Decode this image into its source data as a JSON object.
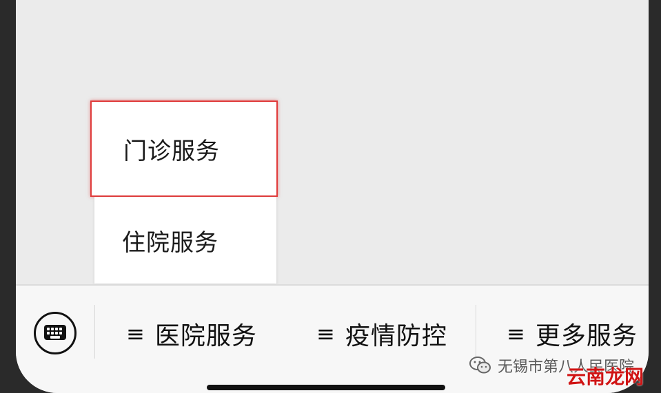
{
  "popup_menu": {
    "items": [
      {
        "label": "门诊服务",
        "selected": true
      },
      {
        "label": "住院服务",
        "selected": false
      }
    ],
    "highlight_color": "#e03b3b"
  },
  "bottom_bar": {
    "keyboard_icon": "keyboard-icon",
    "menus": [
      {
        "icon": "≡",
        "label": "医院服务"
      },
      {
        "icon": "≡",
        "label": "疫情防控"
      },
      {
        "icon": "≡",
        "label": "更多服务"
      }
    ]
  },
  "watermark": {
    "account": "无锡市第八人民医院",
    "site": "云南龙网",
    "site_color": "#d01414"
  }
}
